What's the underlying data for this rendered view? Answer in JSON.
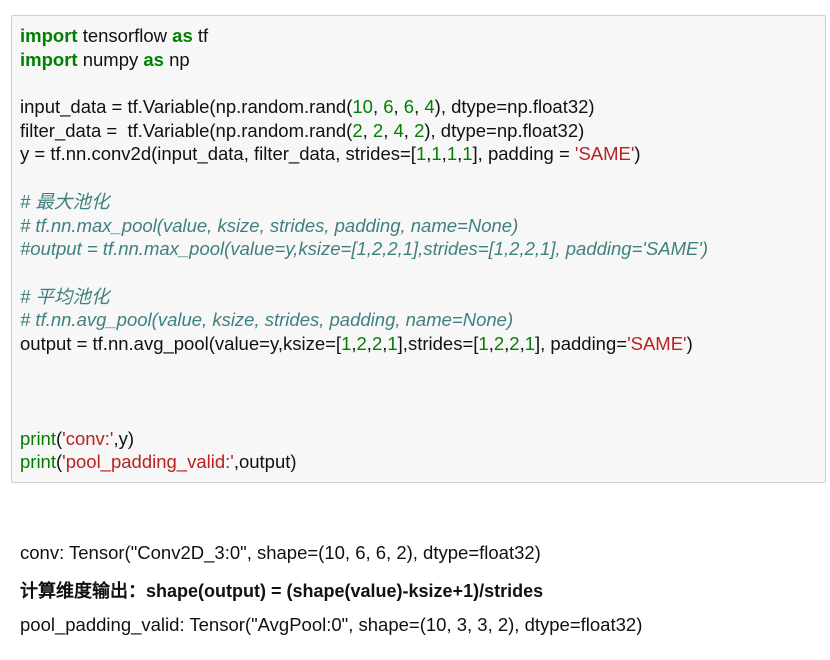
{
  "code_cell": {
    "lines": [
      [
        {
          "t": "import",
          "c": "kw"
        },
        {
          "t": " tensorflow ",
          "c": ""
        },
        {
          "t": "as",
          "c": "kw"
        },
        {
          "t": " tf",
          "c": ""
        }
      ],
      [
        {
          "t": "import",
          "c": "kw"
        },
        {
          "t": " numpy ",
          "c": ""
        },
        {
          "t": "as",
          "c": "kw"
        },
        {
          "t": " np",
          "c": ""
        }
      ],
      [],
      [
        {
          "t": "input_data = tf.Variable(np.random.rand(",
          "c": ""
        },
        {
          "t": "10",
          "c": "num"
        },
        {
          "t": ", ",
          "c": ""
        },
        {
          "t": "6",
          "c": "num"
        },
        {
          "t": ", ",
          "c": ""
        },
        {
          "t": "6",
          "c": "num"
        },
        {
          "t": ", ",
          "c": ""
        },
        {
          "t": "4",
          "c": "num"
        },
        {
          "t": "), dtype=np.float32)",
          "c": ""
        }
      ],
      [
        {
          "t": "filter_data =  tf.Variable(np.random.rand(",
          "c": ""
        },
        {
          "t": "2",
          "c": "num"
        },
        {
          "t": ", ",
          "c": ""
        },
        {
          "t": "2",
          "c": "num"
        },
        {
          "t": ", ",
          "c": ""
        },
        {
          "t": "4",
          "c": "num"
        },
        {
          "t": ", ",
          "c": ""
        },
        {
          "t": "2",
          "c": "num"
        },
        {
          "t": "), dtype=np.float32)",
          "c": ""
        }
      ],
      [
        {
          "t": "y = tf.nn.conv2d(input_data, filter_data, strides=[",
          "c": ""
        },
        {
          "t": "1",
          "c": "num"
        },
        {
          "t": ",",
          "c": ""
        },
        {
          "t": "1",
          "c": "num"
        },
        {
          "t": ",",
          "c": ""
        },
        {
          "t": "1",
          "c": "num"
        },
        {
          "t": ",",
          "c": ""
        },
        {
          "t": "1",
          "c": "num"
        },
        {
          "t": "], padding = ",
          "c": ""
        },
        {
          "t": "'SAME'",
          "c": "str"
        },
        {
          "t": ")",
          "c": ""
        }
      ],
      [],
      [
        {
          "t": "# 最大池化",
          "c": "cm"
        }
      ],
      [
        {
          "t": "# tf.nn.max_pool(value, ksize, strides, padding, name=None)",
          "c": "cm"
        }
      ],
      [
        {
          "t": "#output = tf.nn.max_pool(value=y,ksize=[1,2,2,1],strides=[1,2,2,1], padding='SAME')",
          "c": "cm"
        }
      ],
      [],
      [
        {
          "t": "# 平均池化",
          "c": "cm"
        }
      ],
      [
        {
          "t": "# tf.nn.avg_pool(value, ksize, strides, padding, name=None)",
          "c": "cm"
        }
      ],
      [
        {
          "t": "output = tf.nn.avg_pool(value=y,ksize=[",
          "c": ""
        },
        {
          "t": "1",
          "c": "num"
        },
        {
          "t": ",",
          "c": ""
        },
        {
          "t": "2",
          "c": "num"
        },
        {
          "t": ",",
          "c": ""
        },
        {
          "t": "2",
          "c": "num"
        },
        {
          "t": ",",
          "c": ""
        },
        {
          "t": "1",
          "c": "num"
        },
        {
          "t": "],strides=[",
          "c": ""
        },
        {
          "t": "1",
          "c": "num"
        },
        {
          "t": ",",
          "c": ""
        },
        {
          "t": "2",
          "c": "num"
        },
        {
          "t": ",",
          "c": ""
        },
        {
          "t": "2",
          "c": "num"
        },
        {
          "t": ",",
          "c": ""
        },
        {
          "t": "1",
          "c": "num"
        },
        {
          "t": "], padding=",
          "c": ""
        },
        {
          "t": "'SAME'",
          "c": "str"
        },
        {
          "t": ")",
          "c": ""
        }
      ],
      [],
      [],
      [],
      [
        {
          "t": "print",
          "c": "bi"
        },
        {
          "t": "(",
          "c": ""
        },
        {
          "t": "'conv:'",
          "c": "str"
        },
        {
          "t": ",y)",
          "c": ""
        }
      ],
      [
        {
          "t": "print",
          "c": "bi"
        },
        {
          "t": "(",
          "c": ""
        },
        {
          "t": "'pool_padding_valid:'",
          "c": "str"
        },
        {
          "t": ",output)",
          "c": ""
        }
      ]
    ]
  },
  "output": {
    "line1": "conv: Tensor(\"Conv2D_3:0\", shape=(10, 6, 6, 2), dtype=float32)",
    "line2": "pool_padding_valid: Tensor(\"AvgPool:0\", shape=(10, 3, 3, 2), dtype=float32)"
  },
  "note": "计算维度输出：shape(output) = (shape(value)-ksize+1)/strides"
}
